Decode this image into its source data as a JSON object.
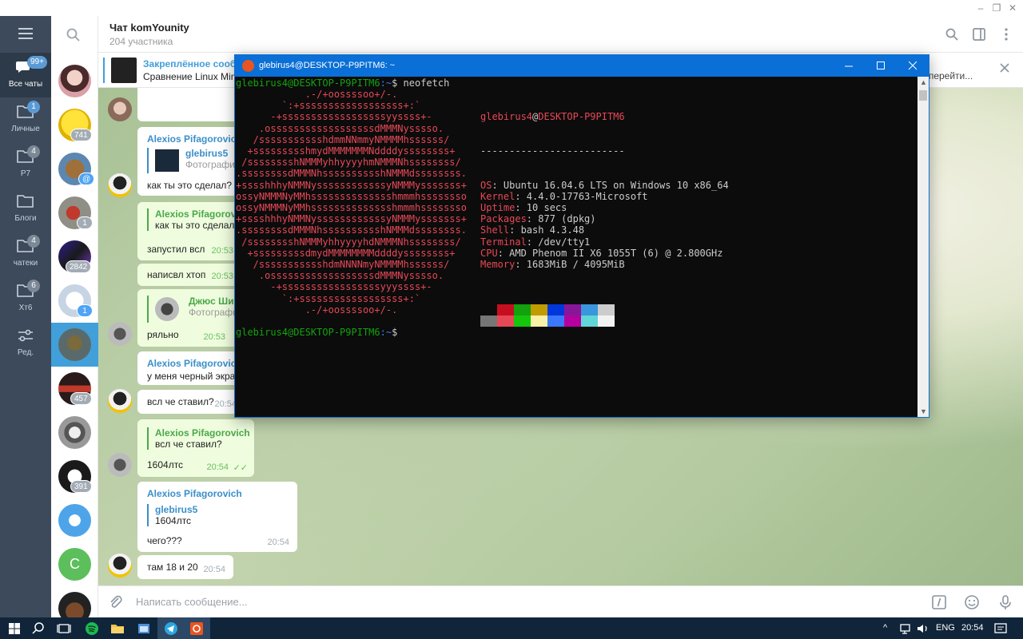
{
  "folders": [
    {
      "label": "Все чаты",
      "badge": "99+",
      "active": true
    },
    {
      "label": "Личные",
      "badge": "1"
    },
    {
      "label": "P7",
      "badge": "4"
    },
    {
      "label": "Блоги",
      "badge": ""
    },
    {
      "label": "чатеки",
      "badge": "4"
    },
    {
      "label": "Хт6",
      "badge": "6"
    },
    {
      "label": "Ред.",
      "badge": ""
    }
  ],
  "chat_list_badges": [
    "",
    "741",
    "",
    "1",
    "2842",
    "1",
    "",
    "457",
    "",
    "391",
    "",
    "",
    ""
  ],
  "chat_list_letter_avatar": "С",
  "header": {
    "title": "Чат komYounity",
    "subtitle": "204 участника"
  },
  "pinned": {
    "title": "Закреплённое сообщение",
    "text": "Сравнение Linux Mint",
    "goto": "т перейти..."
  },
  "messages": [
    {
      "author": "Alexios Pifagorovich",
      "reply_name": "glebirus5",
      "reply_text": "Фотография",
      "text": "как ты это сделал?"
    },
    {
      "author": "Alexios Pifagorovich",
      "text": "как ты это сделал?"
    },
    {
      "text": "запустил всл",
      "time": "20:53"
    },
    {
      "text": "написвл хтоп",
      "time": "20:53"
    },
    {
      "reply_name": "Джюс Шипов",
      "reply_text": "Фотография",
      "text": "ряльно",
      "time": "20:53"
    },
    {
      "author": "Alexios Pifagorovich",
      "text": "у меня черный экран"
    },
    {
      "text": "всл че ставил?",
      "time": "20:54"
    },
    {
      "reply_name": "Alexios Pifagorovich",
      "reply_text": "всл че ставил?",
      "text": "1604лтс",
      "time": "20:54"
    },
    {
      "author": "Alexios Pifagorovich",
      "reply_name": "glebirus5",
      "reply_text": "1604лтс",
      "text": "чего???",
      "time": "20:54"
    },
    {
      "text": "там 18 и 20",
      "time": "20:54"
    }
  ],
  "composer": {
    "placeholder": "Написать сообщение..."
  },
  "terminal": {
    "title": "glebirus4@DESKTOP-P9PITM6: ~",
    "prompt_user": "glebirus4@DESKTOP-P9PITM6",
    "prompt_path": ":~",
    "prompt_dollar": "$",
    "command": " neofetch",
    "ascii_logo": [
      "            .-/+oossssoo+/-.",
      "        `:+ssssssssssssssssss+:`",
      "      -+ssssssssssssssssssyyssss+-",
      "    .ossssssssssssssssssdMMMNysssso.",
      "   /ssssssssssshdmmNNmmyNMMMMhssssss/",
      "  +ssssssssshmydMMMMMMMNddddyssssssss+",
      " /sssssssshNMMMyhhyyyyhmNMMMNhssssssss/",
      ".ssssssssdMMMNhsssssssssshNMMMdssssssss.",
      "+sssshhhyNMMNyssssssssssssyNMMMysssssss+",
      "ossyNMMMNyMMhsssssssssssssshmmmhssssssso",
      "ossyNMMMNyMMhsssssssssssssshmmmhssssssso",
      "+sssshhhyNMMNyssssssssssssyNMMMysssssss+",
      ".ssssssssdMMMNhsssssssssshNMMMdssssssss.",
      " /sssssssshNMMMyhhyyyyhdNMMMNhssssssss/",
      "  +sssssssssdmydMMMMMMMMddddyssssssss+",
      "   /ssssssssssshdmNNNNmyNMMMMhssssss/",
      "    .ossssssssssssssssssdMMMNysssso.",
      "      -+sssssssssssssssssyyyssss+-",
      "        `:+ssssssssssssssssss+:`",
      "            .-/+oossssoo+/-."
    ],
    "info_user": "glebirus4",
    "info_at": "@",
    "info_host": "DESKTOP-P9PITM6",
    "info_sep": "-------------------------",
    "info": [
      {
        "key": "OS",
        "value": ": Ubuntu 16.04.6 LTS on Windows 10 x86_64"
      },
      {
        "key": "Kernel",
        "value": ": 4.4.0-17763-Microsoft"
      },
      {
        "key": "Uptime",
        "value": ": 10 secs"
      },
      {
        "key": "Packages",
        "value": ": 877 (dpkg)"
      },
      {
        "key": "Shell",
        "value": ": bash 4.3.48"
      },
      {
        "key": "Terminal",
        "value": ": /dev/tty1"
      },
      {
        "key": "CPU",
        "value": ": AMD Phenom II X6 1055T (6) @ 2.800GHz"
      },
      {
        "key": "Memory",
        "value": ": 1683MiB / 4095MiB"
      }
    ],
    "palette_top": [
      "#0c0c0c",
      "#c50f1f",
      "#13a10e",
      "#c19c00",
      "#0037da",
      "#881798",
      "#3a96dd",
      "#cccccc"
    ],
    "palette_bottom": [
      "#767676",
      "#e74856",
      "#16c60c",
      "#f9f1a5",
      "#3b78ff",
      "#b4009e",
      "#61d6d6",
      "#f2f2f2"
    ]
  },
  "taskbar": {
    "lang": "ENG",
    "time": "20:54"
  }
}
